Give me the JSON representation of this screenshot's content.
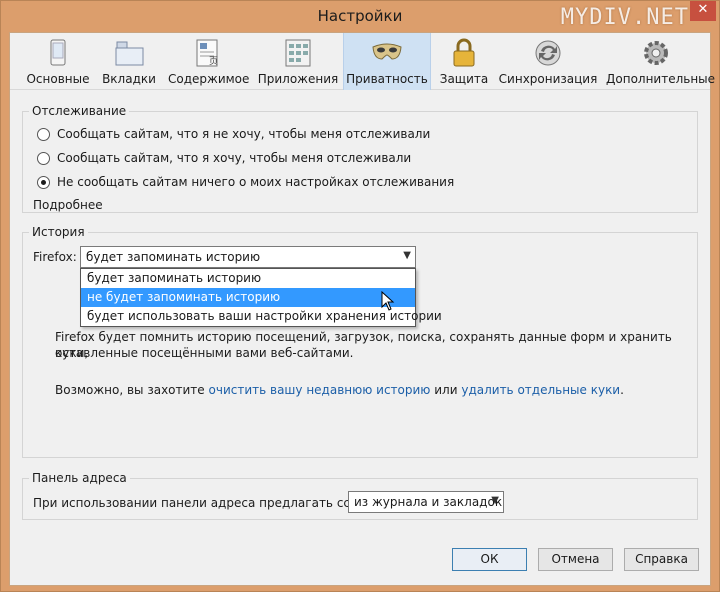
{
  "window": {
    "title": "Настройки",
    "watermark": "MYDIV.NET",
    "close_glyph": "✕"
  },
  "toolbar": {
    "items": [
      {
        "label": "Основные",
        "icon": "general-icon"
      },
      {
        "label": "Вкладки",
        "icon": "tabs-icon"
      },
      {
        "label": "Содержимое",
        "icon": "content-icon"
      },
      {
        "label": "Приложения",
        "icon": "applications-icon"
      },
      {
        "label": "Приватность",
        "icon": "privacy-mask-icon",
        "active": true
      },
      {
        "label": "Защита",
        "icon": "lock-icon"
      },
      {
        "label": "Синхронизация",
        "icon": "sync-icon"
      },
      {
        "label": "Дополнительные",
        "icon": "gear-icon"
      }
    ]
  },
  "tracking": {
    "legend": "Отслеживание",
    "options": [
      "Сообщать сайтам, что я не хочу, чтобы меня отслеживали",
      "Сообщать сайтам, что я хочу, чтобы меня отслеживали",
      "Не сообщать сайтам ничего о моих настройках отслеживания"
    ],
    "selected_index": 2,
    "more_link": "Подробнее"
  },
  "history": {
    "legend": "История",
    "firefox_label": "Firefox:",
    "select_value": "будет запоминать историю",
    "dropdown_options": [
      "будет запоминать историю",
      "не будет запоминать историю",
      "будет использовать ваши настройки хранения истории"
    ],
    "highlighted_index": 1,
    "desc_line1": "Firefox будет помнить историю посещений, загрузок, поиска, сохранять данные форм и хранить куки,",
    "desc_line2": "оставленные посещёнными вами веб-сайтами.",
    "maybe_prefix": "Возможно, вы захотите",
    "clear_link": "очистить вашу недавнюю историю",
    "or_text": "или",
    "remove_cookies_link": "удалить отдельные куки",
    "period": "."
  },
  "address_bar": {
    "legend": "Панель адреса",
    "label": "При использовании панели адреса предлагать ссылки:",
    "select_value": "из журнала и закладок"
  },
  "buttons": {
    "ok": "ОК",
    "cancel": "Отмена",
    "help": "Справка"
  },
  "colors": {
    "accent": "#3399ff",
    "link": "#1c5fa8",
    "titlebar": "#dc9e6c"
  }
}
